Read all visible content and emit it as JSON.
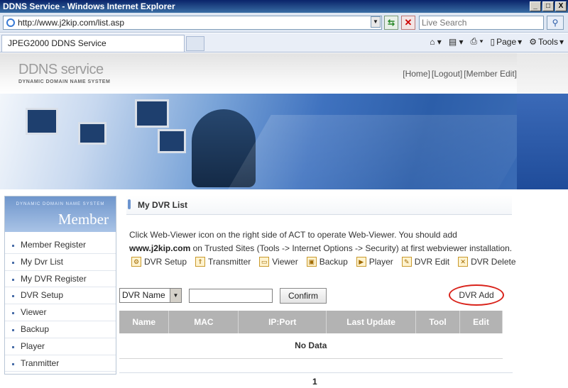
{
  "window": {
    "title": "DDNS Service - Windows Internet Explorer",
    "controls": [
      "_",
      "□",
      "X"
    ]
  },
  "address_bar": {
    "url": "http://www.j2kip.com/list.asp",
    "search_placeholder": "Live Search"
  },
  "tabs": [
    {
      "label": "JPEG2000 DDNS Service"
    }
  ],
  "command_bar": {
    "page_label": "Page",
    "tools_label": "Tools"
  },
  "site": {
    "logo": "DDNS service",
    "logo_subtitle": "DYNAMIC DOMAIN NAME SYSTEM",
    "top_links": [
      "[Home]",
      "[Logout]",
      "[Member Edit]"
    ]
  },
  "sidebar": {
    "header_small": "DYNAMIC DOMAIN NAME SYSTEM",
    "header_title": "Member",
    "items": [
      {
        "label": "Member Register"
      },
      {
        "label": "My Dvr List"
      },
      {
        "label": "My DVR Register"
      },
      {
        "label": "DVR Setup"
      },
      {
        "label": "Viewer"
      },
      {
        "label": "Backup"
      },
      {
        "label": "Player"
      },
      {
        "label": "Tranmitter"
      }
    ]
  },
  "content": {
    "title": "My DVR List",
    "description_part1": "Click Web-Viewer icon on the right side of ACT to operate Web-Viewer. You should add ",
    "description_bold": "www.j2kip.com",
    "description_part2": " on Trusted Sites (Tools -> Internet Options -> Security) at first webviewer installation.",
    "legend": [
      {
        "icon": "gear-icon",
        "label": "DVR Setup"
      },
      {
        "icon": "transmitter-icon",
        "label": "Transmitter"
      },
      {
        "icon": "monitor-icon",
        "label": "Viewer"
      },
      {
        "icon": "disk-icon",
        "label": "Backup"
      },
      {
        "icon": "play-icon",
        "label": "Player"
      },
      {
        "icon": "edit-icon",
        "label": "DVR Edit"
      },
      {
        "icon": "delete-icon",
        "label": "DVR Delete"
      }
    ],
    "search_select_value": "DVR Name",
    "search_input_value": "",
    "confirm_label": "Confirm",
    "add_label": "DVR Add",
    "table": {
      "columns": [
        "Name",
        "MAC",
        "IP:Port",
        "Last Update",
        "Tool",
        "Edit"
      ],
      "empty_message": "No Data"
    },
    "pager": "1"
  }
}
